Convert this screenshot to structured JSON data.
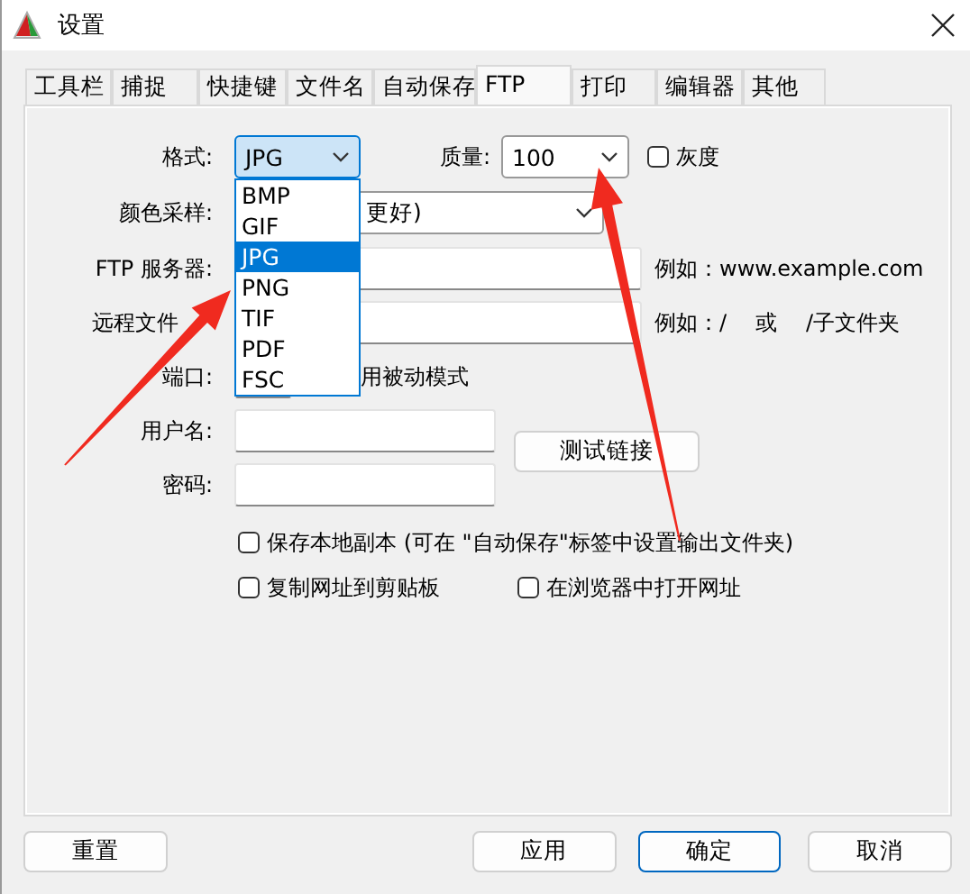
{
  "window": {
    "title": "设置"
  },
  "tabs": [
    {
      "label": "工具栏",
      "selected": false
    },
    {
      "label": "捕捉",
      "selected": false
    },
    {
      "label": "快捷键",
      "selected": false
    },
    {
      "label": "文件名",
      "selected": false
    },
    {
      "label": "自动保存",
      "selected": false
    },
    {
      "label": "FTP",
      "selected": true
    },
    {
      "label": "打印",
      "selected": false
    },
    {
      "label": "编辑器",
      "selected": false
    },
    {
      "label": "其他",
      "selected": false
    }
  ],
  "format": {
    "label": "格式:",
    "value": "JPG",
    "expanded": true,
    "options": [
      {
        "label": "BMP",
        "selected": false
      },
      {
        "label": "GIF",
        "selected": false
      },
      {
        "label": "JPG",
        "selected": true
      },
      {
        "label": "PNG",
        "selected": false
      },
      {
        "label": "TIF",
        "selected": false
      },
      {
        "label": "PDF",
        "selected": false
      },
      {
        "label": "FSC",
        "selected": false
      }
    ]
  },
  "quality": {
    "label": "质量:",
    "value": "100"
  },
  "grayscale": {
    "label": "灰度",
    "checked": false
  },
  "color_sampling": {
    "label": "颜色采样:",
    "value": "更好)"
  },
  "ftp_server": {
    "label": "FTP 服务器:",
    "hint": "例如：www.example.com"
  },
  "remote_folder": {
    "label": "远程文件",
    "hint": [
      "例如：/",
      "或",
      "/子文件夹"
    ]
  },
  "port": {
    "label": "端口:"
  },
  "passive_mode": {
    "label": "用被动模式"
  },
  "username": {
    "label": "用户名:"
  },
  "password": {
    "label": "密码:"
  },
  "test_button": "测试链接",
  "options": [
    {
      "label": "保存本地副本 (可在 \"自动保存\"标签中设置输出文件夹)",
      "checked": false
    },
    {
      "label": "复制网址到剪贴板",
      "checked": false
    },
    {
      "label": "在浏览器中打开网址",
      "checked": false
    }
  ],
  "buttons": [
    {
      "label": "重置",
      "kind": "normal"
    },
    {
      "label": "应用",
      "kind": "normal"
    },
    {
      "label": "确定",
      "kind": "default"
    },
    {
      "label": "取消",
      "kind": "normal"
    }
  ]
}
